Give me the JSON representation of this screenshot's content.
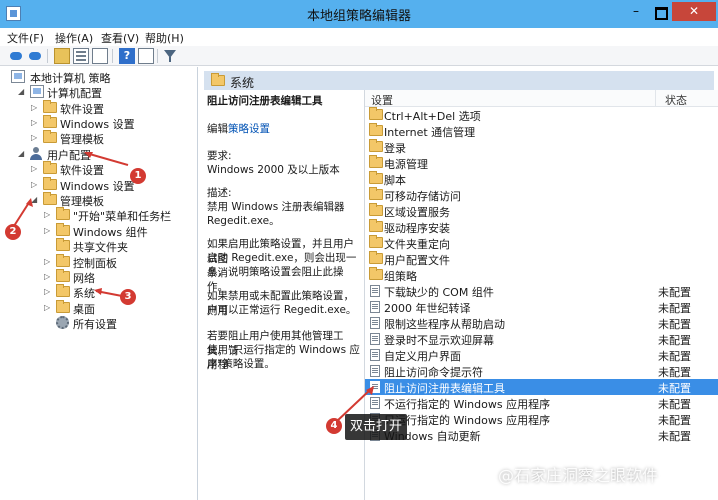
{
  "window": {
    "title": "本地组策略编辑器",
    "controls": {
      "minimize": "–",
      "maximize": "",
      "close": "✕"
    }
  },
  "menu": [
    "文件(F)",
    "操作(A)",
    "查看(V)",
    "帮助(H)"
  ],
  "toolbar_icons": [
    "back-arrow-icon",
    "forward-arrow-icon",
    "up-folder-icon",
    "show-hide-tree-icon",
    "export-list-icon",
    "help-icon",
    "properties-icon",
    "filter-icon"
  ],
  "tree": {
    "root": "本地计算机 策略",
    "computer_config": "计算机配置",
    "cc_software": "软件设置",
    "cc_windows": "Windows 设置",
    "cc_admin": "管理模板",
    "user_config": "用户配置",
    "uc_software": "软件设置",
    "uc_windows": "Windows 设置",
    "uc_admin": "管理模板",
    "start_menu": "\"开始\"菜单和任务栏",
    "windows_components": "Windows 组件",
    "shared_folders": "共享文件夹",
    "control_panel": "控制面板",
    "network": "网络",
    "system": "系统",
    "desktop": "桌面",
    "all_settings": "所有设置"
  },
  "main_header": "系统",
  "description": {
    "title": "阻止访问注册表编辑工具",
    "edit_prefix": "编辑",
    "edit_link": "策略设置",
    "requirement_label": "要求:",
    "requirement": "Windows 2000 及以上版本",
    "desc_label": "描述:",
    "desc_line1": "禁用 Windows 注册表编辑器",
    "desc_line2": "Regedit.exe。",
    "para1_l1": "如果启用此策略设置，并且用户试图",
    "para1_l2": "启动 Regedit.exe，则会出现一条消",
    "para1_l3": "息，说明策略设置会阻止此操作。",
    "para2_l1": "如果禁用或未配置此策略设置，则用",
    "para2_l2": "户可以正常运行 Regedit.exe。",
    "para3_l1": "若要阻止用户使用其他管理工具，请",
    "para3_l2": "使用\"只运行指定的 Windows 应用程",
    "para3_l3": "序\"策略设置。"
  },
  "list": {
    "col_setting": "设置",
    "col_state": "状态",
    "folders": [
      "Ctrl+Alt+Del 选项",
      "Internet 通信管理",
      "登录",
      "电源管理",
      "脚本",
      "可移动存储访问",
      "区域设置服务",
      "驱动程序安装",
      "文件夹重定向",
      "用户配置文件",
      "组策略"
    ],
    "policies": [
      {
        "name": "下载缺少的 COM 组件",
        "state": "未配置"
      },
      {
        "name": "2000 年世纪转译",
        "state": "未配置"
      },
      {
        "name": "限制这些程序从帮助启动",
        "state": "未配置"
      },
      {
        "name": "登录时不显示欢迎屏幕",
        "state": "未配置"
      },
      {
        "name": "自定义用户界面",
        "state": "未配置"
      },
      {
        "name": "阻止访问命令提示符",
        "state": "未配置"
      },
      {
        "name": "阻止访问注册表编辑工具",
        "state": "未配置"
      },
      {
        "name": "不运行指定的 Windows 应用程序",
        "state": "未配置"
      },
      {
        "name": "只运行指定的 Windows 应用程序",
        "state": "未配置"
      },
      {
        "name": "Windows 自动更新",
        "state": "未配置"
      }
    ],
    "selected_index": 6
  },
  "annotations": {
    "badges": [
      "1",
      "2",
      "3",
      "4"
    ],
    "tooltip": "双击打开",
    "badge_color": "#d33a32"
  },
  "watermark": "@石家庄洞察之眼软件",
  "colors": {
    "titlebar": "#55b0ee",
    "selection": "#3a8ee6",
    "close": "#c7463a",
    "header": "#d5e1ef"
  }
}
